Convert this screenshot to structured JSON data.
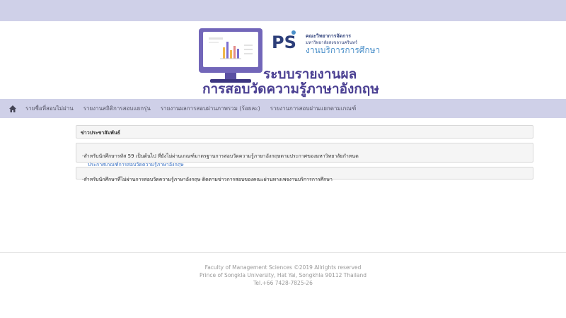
{
  "header": {
    "logo": {
      "mark": "PSU",
      "faculty_line": "คณะวิทยาการจัดการ",
      "university_line": "มหาวิทยาลัยสงขลานครินทร์",
      "office_line": "งานบริการการศึกษา"
    },
    "title_line1": "ระบบรายงานผล",
    "title_line2": "การสอบวัดความรู้ภาษาอังกฤษ",
    "accent_color": "#4a3f92",
    "bar_color": "#cfd0e8"
  },
  "nav": {
    "home_icon": "home-icon",
    "items": [
      {
        "label": "รายชื่อที่สอบไม่ผ่าน"
      },
      {
        "label": "รายงานสถิติการสอบแยกรุ่น"
      },
      {
        "label": "รายงานผลการสอบผ่านภาพรวม (ร้อยละ)"
      },
      {
        "label": "รายงานการสอบผ่านแยกตามเกณฑ์"
      }
    ]
  },
  "news": {
    "heading": "ข่าวประชาสัมพันธ์",
    "items": [
      {
        "text": "-สำหรับนักศึกษารหัส 59 เป็นต้นไป ที่ยังไม่ผ่านเกณฑ์มาตรฐานการสอบวัดความรู้ภาษาอังกฤษตามประกาศของมหาวิทยาลัยกำหนด",
        "link": "ประกาศเกณฑ์การสอบวัดความรู้ภาษาอังกฤษ"
      },
      {
        "text": "-สำหรับนักศึกษาที่ไม่ผ่านการสอบวัดความรู้ภาษาอังกฤษ ติดตามข่าวการสอบของคณะผ่านทางเพจงานบริการการศึกษา"
      }
    ]
  },
  "footer": {
    "line1": "Faculty of Management Sciences ©2019 Allrights reserved",
    "line2": "Prince of Songkla University, Hat Yai, Songkhla 90112 Thailand",
    "line3": "Tel.+66 7428-7825-26"
  }
}
